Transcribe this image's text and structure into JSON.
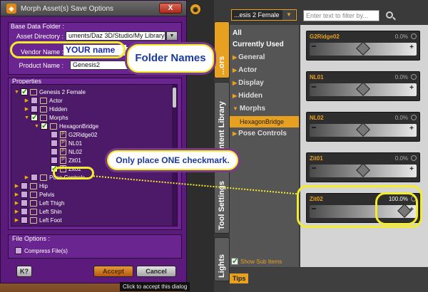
{
  "dialog": {
    "title": "Morph Asset(s) Save Options",
    "close_label": "X",
    "base_folder_label": "Base Data Folder :",
    "asset_directory_label": "Asset Directory :",
    "asset_directory_value": "uments/Daz 3D/Studio/My Library",
    "vendor_name_label": "Vendor Name :",
    "vendor_name_value": "YOUR name",
    "product_name_label": "Product Name :",
    "product_name_value": "Genesis2",
    "properties_label": "Properties",
    "tree": [
      {
        "label": "Genesis 2 Female",
        "indent": 0,
        "check": true,
        "icon": "folder",
        "expanded": true
      },
      {
        "label": "Actor",
        "indent": 1,
        "check": false,
        "icon": "folder",
        "expanded": false
      },
      {
        "label": "Hidden",
        "indent": 1,
        "check": false,
        "icon": "folder",
        "expanded": false
      },
      {
        "label": "Morphs",
        "indent": 1,
        "check": true,
        "icon": "folder",
        "expanded": true
      },
      {
        "label": "HexagonBridge",
        "indent": 2,
        "check": true,
        "icon": "folder",
        "expanded": true
      },
      {
        "label": "G2Ridge02",
        "indent": 3,
        "check": false,
        "icon": "doc"
      },
      {
        "label": "NL01",
        "indent": 3,
        "check": false,
        "icon": "doc"
      },
      {
        "label": "NL02",
        "indent": 3,
        "check": false,
        "icon": "doc"
      },
      {
        "label": "Zit01",
        "indent": 3,
        "check": false,
        "icon": "doc"
      },
      {
        "label": "Zit02",
        "indent": 3,
        "check": true,
        "icon": "doc"
      },
      {
        "label": "Pose Controls",
        "indent": 1,
        "check": false,
        "icon": "folder",
        "expanded": false
      },
      {
        "label": "Hip",
        "indent": 0,
        "check": false,
        "icon": "folder",
        "expanded": false
      },
      {
        "label": "Pelvis",
        "indent": 0,
        "check": false,
        "icon": "folder",
        "expanded": false
      },
      {
        "label": "Left Thigh",
        "indent": 0,
        "check": false,
        "icon": "folder",
        "expanded": false
      },
      {
        "label": "Left Shin",
        "indent": 0,
        "check": false,
        "icon": "folder",
        "expanded": false
      },
      {
        "label": "Left Foot",
        "indent": 0,
        "check": false,
        "icon": "folder",
        "expanded": false
      }
    ],
    "file_options_label": "File Options :",
    "compress_label": "Compress File(s)",
    "help_label": "K?",
    "accept_label": "Accept",
    "cancel_label": "Cancel",
    "tooltip": "Click to accept this dialog"
  },
  "sidebar_tabs": {
    "parameters": "...ors",
    "content_library": "Content Library",
    "tool_settings": "Tool Settings",
    "lights": "Lights"
  },
  "pane": {
    "category_dropdown": "...esis 2 Female",
    "filter_placeholder": "Enter text to filter by...",
    "categories": [
      {
        "label": "All",
        "arrow": false,
        "selected": true,
        "sub": false
      },
      {
        "label": "Currently Used",
        "arrow": false,
        "selected": true,
        "sub": false
      },
      {
        "label": "General",
        "arrow": true,
        "selected": false,
        "sub": false
      },
      {
        "label": "Actor",
        "arrow": true,
        "selected": false,
        "sub": false
      },
      {
        "label": "Display",
        "arrow": true,
        "selected": false,
        "sub": false
      },
      {
        "label": "Hidden",
        "arrow": true,
        "selected": false,
        "sub": false
      },
      {
        "label": "Morphs",
        "arrow": true,
        "selected": false,
        "sub": false,
        "expanded": true
      },
      {
        "label": "HexagonBridge",
        "arrow": false,
        "selected": false,
        "sub": true
      },
      {
        "label": "Pose Controls",
        "arrow": true,
        "selected": false,
        "sub": false
      }
    ],
    "show_sub_items": "Show Sub Items",
    "sliders": [
      {
        "name": "G2Ridge02",
        "value": "0.0%",
        "fraction": 0.5,
        "live": false
      },
      {
        "name": "NL01",
        "value": "0.0%",
        "fraction": 0.5,
        "live": false
      },
      {
        "name": "NL02",
        "value": "0.0%",
        "fraction": 0.5,
        "live": false
      },
      {
        "name": "Zit01",
        "value": "0.0%",
        "fraction": 0.5,
        "live": false
      },
      {
        "name": "Zit02",
        "value": "100.0%",
        "fraction": 1.0,
        "live": true
      }
    ],
    "tips_label": "Tips"
  },
  "annotations": {
    "folder_names": "Folder Names",
    "one_checkmark": "Only place ONE checkmark."
  },
  "colors": {
    "dialog_purple": "#5c1a7c",
    "accent_orange": "#e8a020",
    "annotation_yellow": "#f2ec2a",
    "annotation_text": "#1a3aa0"
  }
}
